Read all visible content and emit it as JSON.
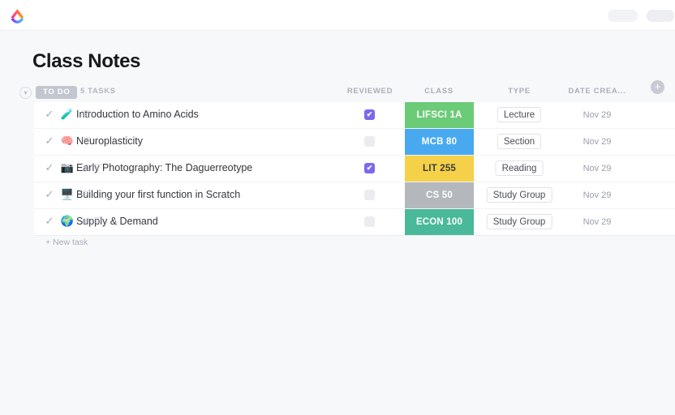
{
  "topbar": {
    "logo_name": "clickup-logo",
    "skeleton_a": "",
    "skeleton_b": ""
  },
  "page": {
    "title": "Class Notes",
    "new_task_label": "+ New task"
  },
  "group": {
    "collapse_icon": "▾",
    "status_label": "TO DO",
    "status_color": "#c2c6ce",
    "task_count": "5 TASKS"
  },
  "columns": {
    "reviewed": "REVIEWED",
    "class": "CLASS",
    "type": "TYPE",
    "date_created": "DATE CREA...",
    "add_column": "+"
  },
  "rows": [
    {
      "check": "✓",
      "emoji": "🧪",
      "emoji_name": "test-tube-emoji",
      "title": "Introduction to Amino Acids",
      "has_attachment": false,
      "has_description": true,
      "reviewed": true,
      "class_label": "LIFSCI 1A",
      "class_color": "#6bcb77",
      "class_text_color": "#ffffff",
      "type": "Lecture",
      "date": "Nov 29"
    },
    {
      "check": "✓",
      "emoji": "🧠",
      "emoji_name": "brain-emoji",
      "title": "Neuroplasticity",
      "has_attachment": false,
      "has_description": true,
      "reviewed": false,
      "class_label": "MCB 80",
      "class_color": "#48a9f0",
      "class_text_color": "#ffffff",
      "type": "Section",
      "date": "Nov 29"
    },
    {
      "check": "✓",
      "emoji": "📷",
      "emoji_name": "camera-emoji",
      "title": "Early Photography: The Daguerreotype",
      "has_attachment": true,
      "has_description": true,
      "reviewed": true,
      "class_label": "LIT 255",
      "class_color": "#f4d148",
      "class_text_color": "#3c3c3c",
      "type": "Reading",
      "date": "Nov 29"
    },
    {
      "check": "✓",
      "emoji": "🖥️",
      "emoji_name": "desktop-computer-emoji",
      "title": "Building your first function in Scratch",
      "has_attachment": false,
      "has_description": true,
      "reviewed": false,
      "class_label": "CS 50",
      "class_color": "#b4b8bd",
      "class_text_color": "#ffffff",
      "type": "Study Group",
      "date": "Nov 29"
    },
    {
      "check": "✓",
      "emoji": "🌍",
      "emoji_name": "globe-emoji",
      "title": "Supply & Demand",
      "has_attachment": true,
      "has_description": true,
      "reviewed": false,
      "class_label": "ECON 100",
      "class_color": "#49b99a",
      "class_text_color": "#ffffff",
      "type": "Study Group",
      "date": "Nov 29"
    }
  ]
}
